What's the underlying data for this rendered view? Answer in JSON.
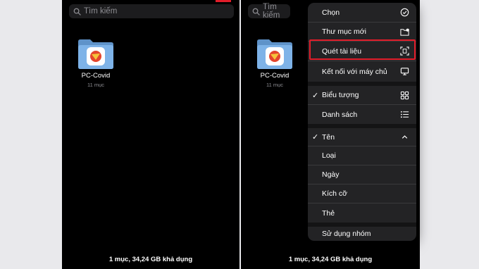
{
  "search": {
    "placeholder": "Tìm kiếm"
  },
  "folder": {
    "name": "PC-Covid",
    "count": "11 mục"
  },
  "footer": {
    "status": "1 mục, 34,24 GB khả dụng"
  },
  "menu": {
    "items": [
      {
        "label": "Chọn",
        "icon": "checkmark-circle-icon"
      },
      {
        "label": "Thư mục mới",
        "icon": "folder-plus-icon"
      },
      {
        "label": "Quét tài liệu",
        "icon": "doc-scanner-icon"
      },
      {
        "label": "Kết nối với máy chủ",
        "icon": "display-icon"
      },
      {
        "label": "Biểu tượng",
        "icon": "grid-icon",
        "checked": true
      },
      {
        "label": "Danh sách",
        "icon": "list-icon"
      },
      {
        "label": "Tên",
        "icon": "chevron-up-icon",
        "checked": true
      },
      {
        "label": "Loại"
      },
      {
        "label": "Ngày"
      },
      {
        "label": "Kích cỡ"
      },
      {
        "label": "Thẻ"
      },
      {
        "label": "Sử dụng nhóm"
      }
    ]
  },
  "colors": {
    "highlight": "#e11d2a",
    "folder": "#7eb3e8",
    "menu_bg": "#232325"
  }
}
